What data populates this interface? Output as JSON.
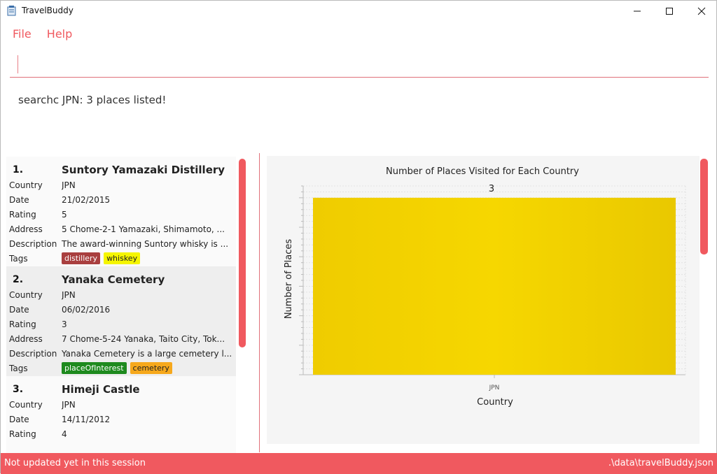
{
  "window": {
    "title": "TravelBuddy"
  },
  "menu": [
    "File",
    "Help"
  ],
  "command": {
    "value": ""
  },
  "result_text": "searchc JPN: 3 places listed!",
  "labels": {
    "country": "Country",
    "date": "Date",
    "rating": "Rating",
    "address": "Address",
    "description": "Description",
    "tags": "Tags"
  },
  "places": [
    {
      "index": "1.",
      "name": "Suntory Yamazaki Distillery",
      "country": "JPN",
      "date": "21/02/2015",
      "rating": "5",
      "address": "5 Chome-2-1 Yamazaki, Shimamoto, ...",
      "description": "The award-winning Suntory whisky is ...",
      "tags": [
        {
          "text": "distillery",
          "bg": "#a93f3f",
          "fg": "#ffffff"
        },
        {
          "text": "whiskey",
          "bg": "#f5f500",
          "fg": "#222222"
        }
      ]
    },
    {
      "index": "2.",
      "name": "Yanaka Cemetery",
      "country": "JPN",
      "date": "06/02/2016",
      "rating": "3",
      "address": "7 Chome-5-24 Yanaka, Taito City, Tok...",
      "description": "Yanaka Cemetery is a large cemetery l...",
      "tags": [
        {
          "text": "placeOfInterest",
          "bg": "#1e8a1e",
          "fg": "#ffffff"
        },
        {
          "text": "cemetery",
          "bg": "#f6a81c",
          "fg": "#222222"
        }
      ]
    },
    {
      "index": "3.",
      "name": "Himeji Castle",
      "country": "JPN",
      "date": "14/11/2012",
      "rating": "4"
    }
  ],
  "chart_data": {
    "type": "bar",
    "title": "Number of Places Visited for Each Country",
    "xlabel": "Country",
    "ylabel": "Number of Places",
    "categories": [
      "JPN"
    ],
    "values": [
      3
    ],
    "data_labels": [
      "3"
    ],
    "ylim": [
      0,
      3.2
    ],
    "bar_color": "#f2d100",
    "grid": true
  },
  "status": {
    "left": "Not updated yet in this session",
    "right": ".\\data\\travelBuddy.json"
  },
  "colors": {
    "accent": "#f0595f"
  }
}
